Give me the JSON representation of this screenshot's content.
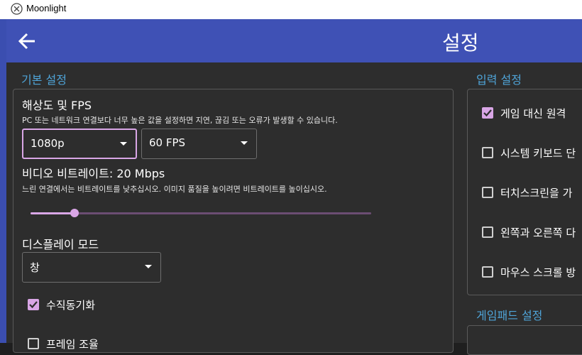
{
  "window": {
    "title": "Moonlight"
  },
  "appbar": {
    "title": "설정",
    "back_icon": "arrow-left-icon"
  },
  "basic": {
    "section_title": "기본 설정",
    "resolution_fps": {
      "title": "해상도 및 FPS",
      "description": "PC 또는 네트워크 연결보다 너무 높은 값을 설정하면 지연, 끊김 또는 오류가 발생할 수 있습니다.",
      "resolution_value": "1080p",
      "fps_value": "60 FPS"
    },
    "bitrate": {
      "title": "비디오 비트레이트: 20 Mbps",
      "description": "느린 연결에서는 비트레이트를 낮추십시오. 이미지 품질을 높이려면 비트레이트를 높이십시오.",
      "value_fraction": 0.13
    },
    "display_mode": {
      "title": "디스플레이 모드",
      "value": "창"
    },
    "vsync": {
      "label": "수직동기화",
      "checked": true
    },
    "frame_pacing": {
      "label": "프레임 조율",
      "checked": false
    }
  },
  "input": {
    "section_title": "입력 설정",
    "options": [
      {
        "label": "게임 대신 원격",
        "checked": true
      },
      {
        "label": "시스템 키보드 단",
        "checked": false
      },
      {
        "label": "터치스크린을 가",
        "checked": false
      },
      {
        "label": "왼쪽과 오른쪽 다",
        "checked": false
      },
      {
        "label": "마우스 스크롤 방",
        "checked": false
      }
    ]
  },
  "gamepad": {
    "section_title": "게임패드 설정"
  },
  "colors": {
    "appbar": "#3f51b5",
    "accent": "#d9a6e6",
    "section_title": "#4fa4d8",
    "background": "#2d2d2d"
  }
}
